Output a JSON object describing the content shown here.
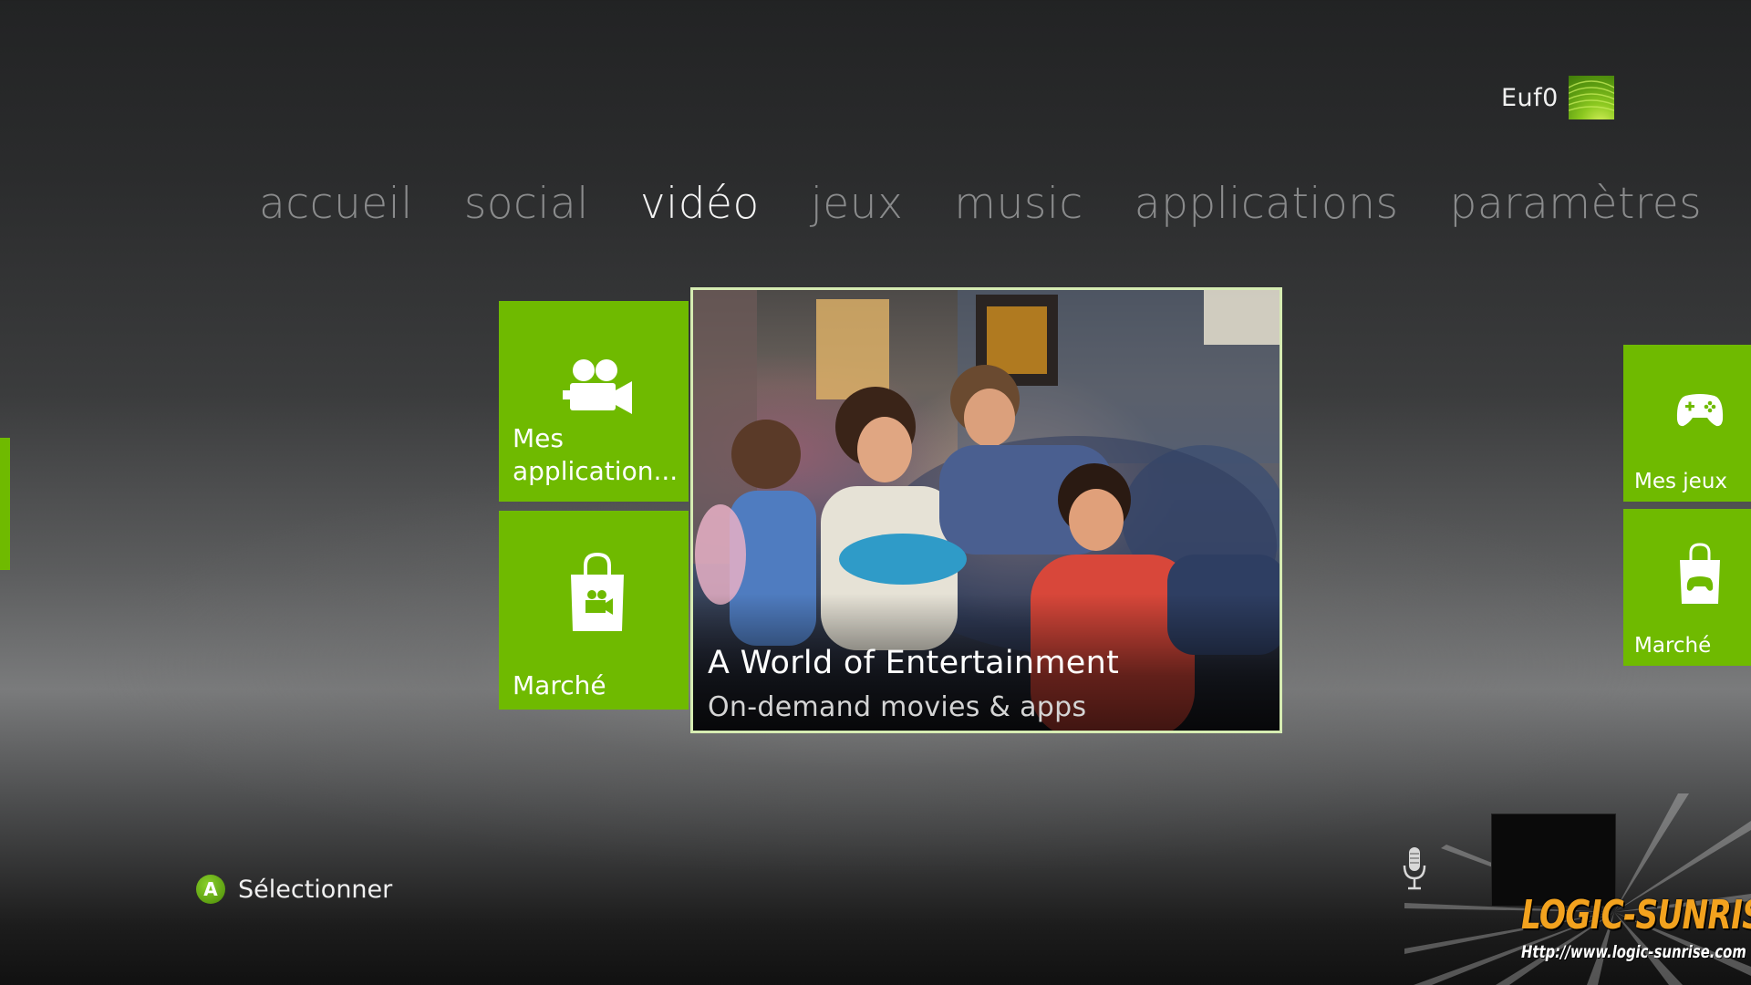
{
  "profile": {
    "gamertag": "Euf0"
  },
  "nav": {
    "items": [
      {
        "label": "accueil"
      },
      {
        "label": "social"
      },
      {
        "label": "vidéo"
      },
      {
        "label": "jeux"
      },
      {
        "label": "music"
      },
      {
        "label": "applications"
      },
      {
        "label": "paramètres"
      }
    ],
    "active": "vidéo"
  },
  "tiles": {
    "my_apps": {
      "label": "Mes application...",
      "icon": "video-camera-icon"
    },
    "market": {
      "label": "Marché",
      "icon": "shopping-bag-camera-icon"
    },
    "featured": {
      "title": "A World of Entertainment",
      "subtitle": "On-demand movies & apps"
    },
    "my_games": {
      "label": "Mes jeux",
      "icon": "controller-icon"
    },
    "games_market": {
      "label": "Marché",
      "icon": "shopping-bag-controller-icon"
    }
  },
  "hint": {
    "button": "A",
    "label": "Sélectionner"
  },
  "watermark": {
    "logo": "LOGIC-SUNRISE",
    "url": "Http://www.logic-sunrise.com"
  },
  "colors": {
    "accent": "#6fba00",
    "nav_inactive": "#8a8b8c",
    "nav_active": "#f4f4f4"
  }
}
